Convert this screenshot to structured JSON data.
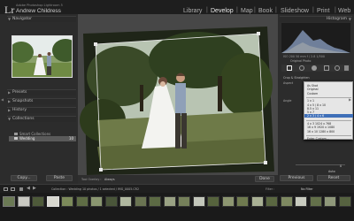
{
  "app": {
    "logo": "Lr",
    "product_line": "Adobe Photoshop Lightroom 5",
    "user_name": "Andrew Childress"
  },
  "modules": [
    "Library",
    "Develop",
    "Map",
    "Book",
    "Slideshow",
    "Print",
    "Web"
  ],
  "active_module": "Develop",
  "left_panel": {
    "navigator_label": "Navigator",
    "sections": [
      "Presets",
      "Snapshots",
      "History",
      "Collections"
    ],
    "collections": [
      {
        "label": "Smart Collections"
      },
      {
        "label": "Wedding",
        "count": "10"
      }
    ],
    "copy_label": "Copy...",
    "paste_label": "Paste"
  },
  "right_panel": {
    "histogram_label": "Histogram",
    "iso_info": "ISO 200   50 mm   f / 2.8   1/500",
    "original_photo_label": "Original Photo",
    "tool_label": "Crop & Straighten",
    "aspect_label": "Aspect",
    "angle_label": "Angle",
    "angle_value": "0",
    "constrain_label": "Constrain To Image",
    "auto_label": "Auto",
    "previous_label": "Previous",
    "reset_label": "Reset",
    "close_label": "Close"
  },
  "aspect_menu": {
    "items": [
      "As Shot",
      "Original",
      "Custom",
      "",
      "1 x 1",
      "4 x 5 / 8 x 10",
      "8.5 x 11",
      "5 x 7",
      "2 x 3 / 4 x 6",
      "",
      "4 x 3            1024 x 768",
      "16 x 9           1920 x 1080",
      "16 x 10          1280 x 800",
      "",
      "Enter Custom..."
    ],
    "selected_index": 8
  },
  "toolbar": {
    "overlay_label": "Tool Overlay :",
    "overlay_value": "Always",
    "done_label": "Done"
  },
  "filmstrip": {
    "page_info": "Collection : Wedding    10 photos / 1 selected / IMG_0005.CR2",
    "filter_label": "Filter :",
    "filter_value": "No Filter"
  }
}
